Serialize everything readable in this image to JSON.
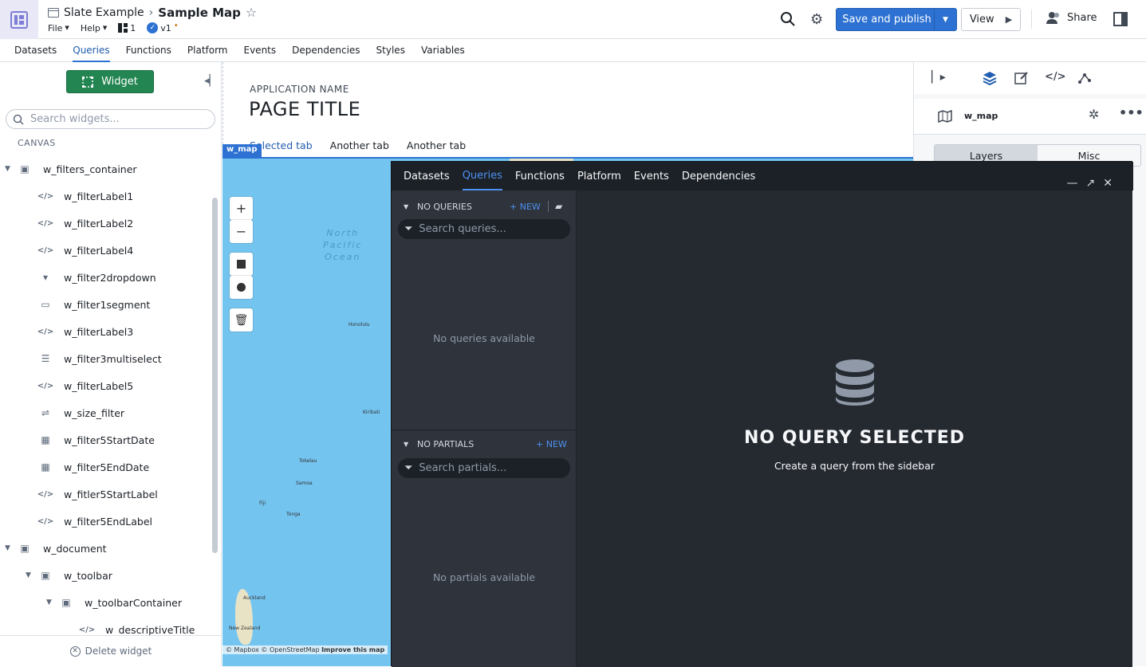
{
  "header": {
    "project": "Slate Example",
    "page": "Sample Map",
    "menus": [
      "File",
      "Help"
    ],
    "pages_count": "1",
    "version": "v1",
    "save_label": "Save and publish",
    "view_label": "View",
    "share_label": "Share"
  },
  "tabs": [
    "Datasets",
    "Queries",
    "Functions",
    "Platform",
    "Events",
    "Dependencies",
    "Styles",
    "Variables"
  ],
  "active_tab": "Queries",
  "left": {
    "widget_button": "Widget",
    "search_placeholder": "Search widgets...",
    "canvas_label": "CANVAS",
    "tree": [
      {
        "label": "w_filters_container",
        "icon": "container-icon",
        "depth": 0,
        "toggle": "expanded"
      },
      {
        "label": "w_filterLabel1",
        "icon": "code-icon",
        "depth": 1
      },
      {
        "label": "w_filterLabel2",
        "icon": "code-icon",
        "depth": 1
      },
      {
        "label": "w_filterLabel4",
        "icon": "code-icon",
        "depth": 1
      },
      {
        "label": "w_filter2dropdown",
        "icon": "dropdown-icon",
        "depth": 1
      },
      {
        "label": "w_filter1segment",
        "icon": "segment-icon",
        "depth": 1
      },
      {
        "label": "w_filterLabel3",
        "icon": "code-icon",
        "depth": 1
      },
      {
        "label": "w_filter3multiselect",
        "icon": "list-icon",
        "depth": 1
      },
      {
        "label": "w_filterLabel5",
        "icon": "code-icon",
        "depth": 1
      },
      {
        "label": "w_size_filter",
        "icon": "slider-icon",
        "depth": 1
      },
      {
        "label": "w_filter5StartDate",
        "icon": "calendar-icon",
        "depth": 1
      },
      {
        "label": "w_filter5EndDate",
        "icon": "calendar-icon",
        "depth": 1
      },
      {
        "label": "w_fitler5StartLabel",
        "icon": "code-icon",
        "depth": 1
      },
      {
        "label": "w_filter5EndLabel",
        "icon": "code-icon",
        "depth": 1
      },
      {
        "label": "w_document",
        "icon": "container-icon",
        "depth": 0,
        "toggle": "expanded"
      },
      {
        "label": "w_toolbar",
        "icon": "container-icon",
        "depth": 1,
        "toggle": "expanded"
      },
      {
        "label": "w_toolbarContainer",
        "icon": "container-icon",
        "depth": 2,
        "toggle": "expanded"
      },
      {
        "label": "w_descriptiveTitle",
        "icon": "code-icon",
        "depth": 3
      }
    ],
    "delete_label": "Delete widget"
  },
  "center": {
    "app_name": "APPLICATION NAME",
    "page_title": "PAGE TITLE",
    "tabs": [
      "Selected tab",
      "Another tab",
      "Another tab"
    ],
    "map_tag": "w_map",
    "ocean": [
      "North",
      "Pacific",
      "Ocean"
    ],
    "places": [
      "Honolulu",
      "Kiribati",
      "Fiji",
      "Samoa",
      "Tonga",
      "Tokelau",
      "Auckland",
      "New Zealand"
    ],
    "attribution": "© Mapbox © OpenStreetMap",
    "attribution_link": "Improve this map"
  },
  "right": {
    "widget_name": "w_map",
    "segments": [
      "Layers",
      "Misc"
    ]
  },
  "dialog": {
    "tabs": [
      "Datasets",
      "Queries",
      "Functions",
      "Platform",
      "Events",
      "Dependencies"
    ],
    "active_tab": "Queries",
    "queries_header": "NO QUERIES",
    "new_label": "+ NEW",
    "search_queries": "Search queries...",
    "no_queries": "No queries available",
    "partials_header": "NO PARTIALS",
    "search_partials": "Search partials...",
    "no_partials": "No partials available",
    "empty_title": "NO QUERY SELECTED",
    "empty_subtitle": "Create a query from the sidebar"
  }
}
